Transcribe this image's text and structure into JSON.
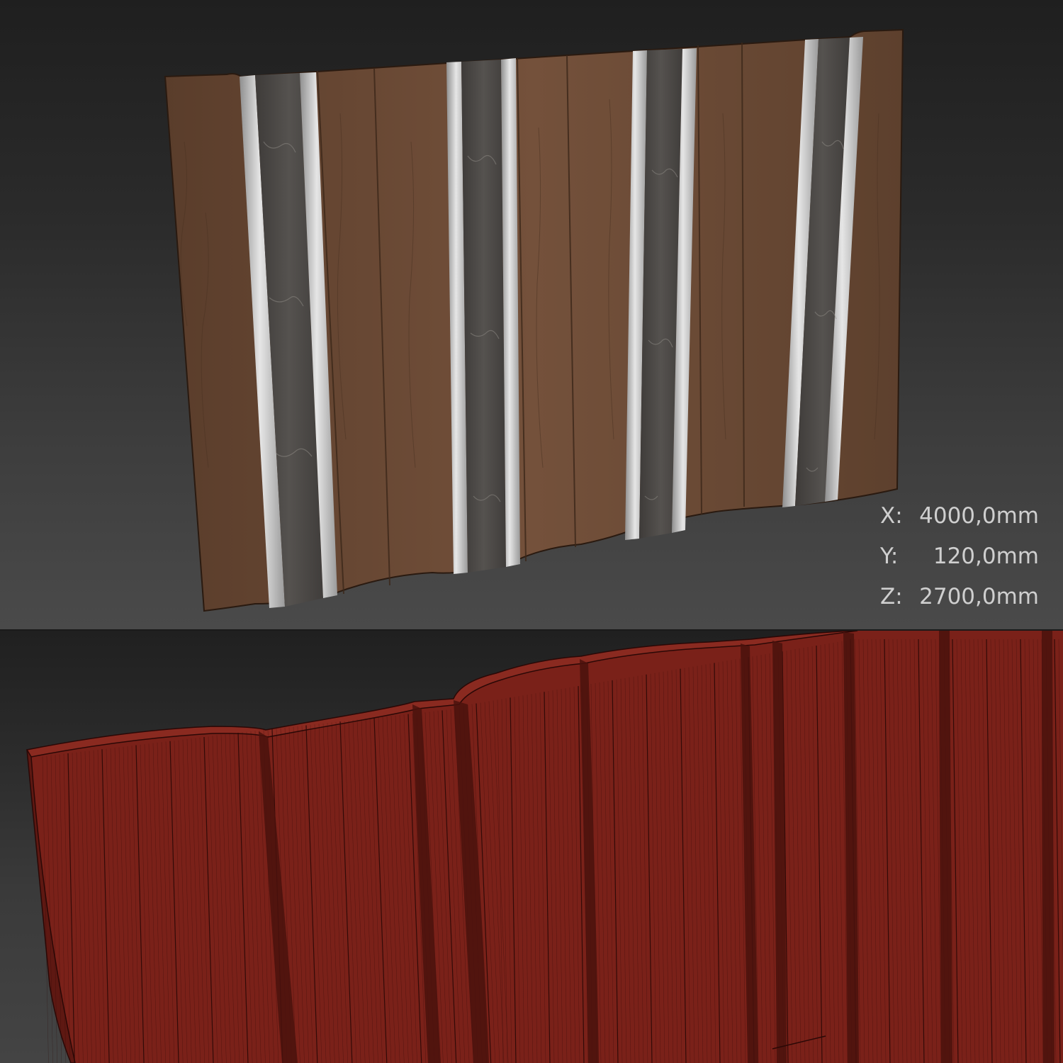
{
  "dimensions": [
    {
      "axis": "X:",
      "value": "4000,0mm"
    },
    {
      "axis": "Y:",
      "value": "120,0mm"
    },
    {
      "axis": "Z:",
      "value": "2700,0mm"
    }
  ],
  "colors": {
    "wood": "#6b4a36",
    "wood_dark": "#4f3524",
    "stone": "#4a4745",
    "metal": "#c9c9c9",
    "wire_surface": "#7a2119",
    "wire_line": "#2a0806",
    "bg_dark": "#202020",
    "bg_light": "#4a4a4a",
    "label": "#cfcfcf"
  }
}
